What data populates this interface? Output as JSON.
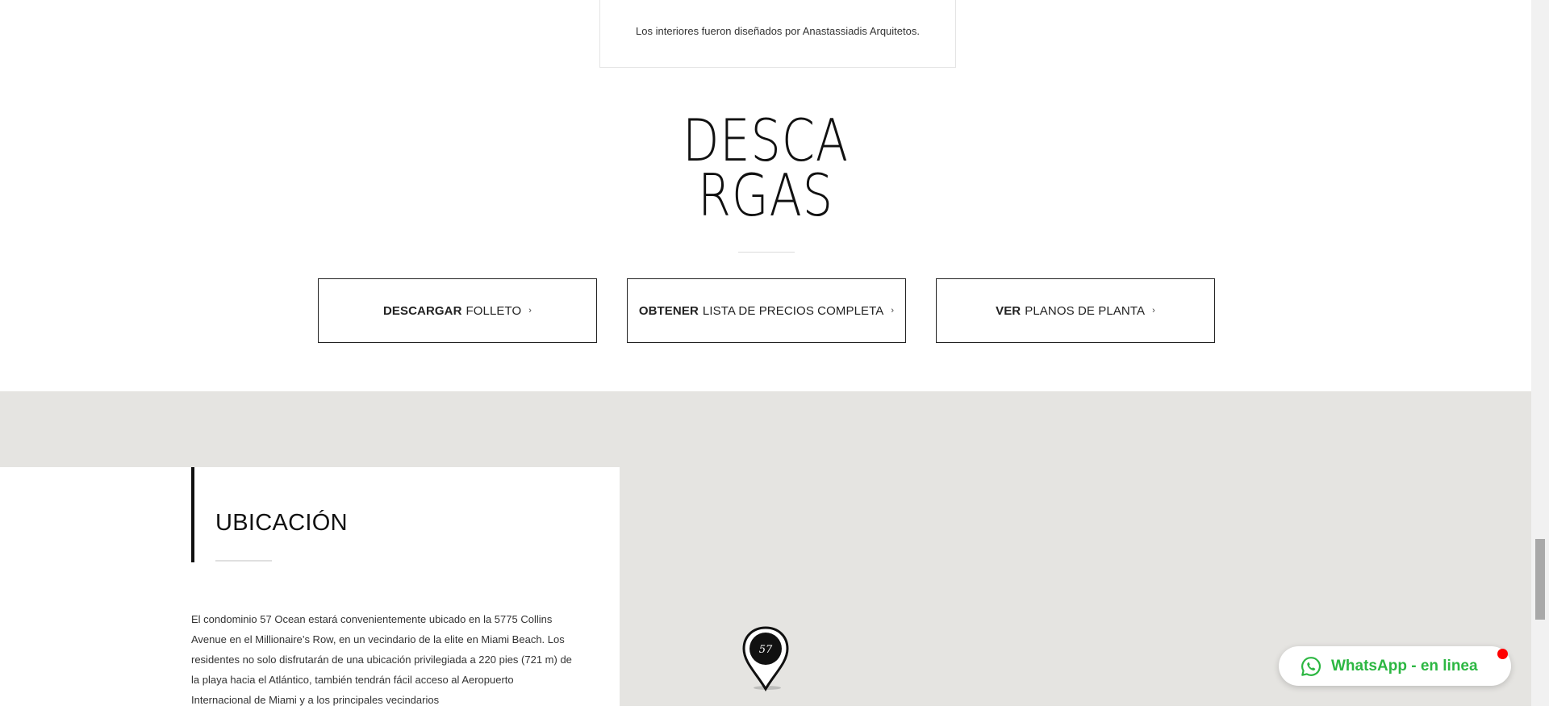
{
  "intro_card": {
    "text": "Los interiores fueron diseñados por Anastassiadis Arquitetos."
  },
  "downloads": {
    "title_line1": "DESCA",
    "title_line2": "RGAS",
    "buttons": [
      {
        "bold": "DESCARGAR",
        "rest": "FOLLETO",
        "chevron": "›"
      },
      {
        "bold": "OBTENER",
        "rest": "LISTA DE PRECIOS COMPLETA",
        "chevron": "›"
      },
      {
        "bold": "VER",
        "rest": "PLANOS DE PLANTA",
        "chevron": "›"
      }
    ]
  },
  "location": {
    "title": "UBICACIÓN",
    "text": "El condominio 57 Ocean estará convenientemente ubicado en la 5775 Collins Avenue en el Millionaire’s Row, en un vecindario de la elite en Miami Beach. Los residentes no solo disfrutarán de una ubicación privilegiada a 220 pies (721 m) de la playa hacia el Atlántico, también tendrán fácil acceso al Aeropuerto Internacional de Miami y a los principales vecindarios",
    "map_pin_label": "57"
  },
  "whatsapp": {
    "label": "WhatsApp - en linea",
    "color": "#2cb742",
    "status_color": "#ff0000"
  },
  "icons": [
    "chevron-right-icon",
    "map-pin-icon",
    "whatsapp-icon"
  ]
}
